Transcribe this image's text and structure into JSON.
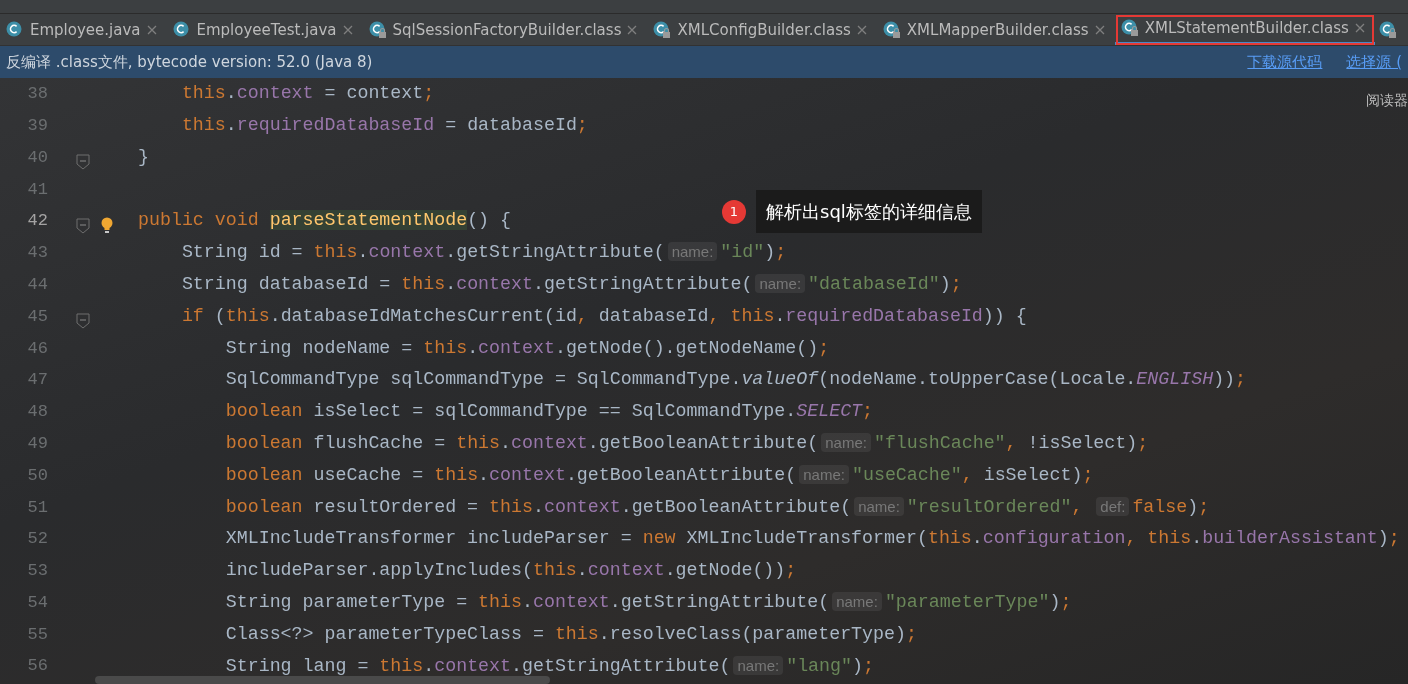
{
  "tabs": [
    {
      "label": "Employee.java",
      "kind": "java",
      "selected": false,
      "annotated": false
    },
    {
      "label": "EmployeeTest.java",
      "kind": "java",
      "selected": false,
      "annotated": false
    },
    {
      "label": "SqlSessionFactoryBuilder.class",
      "kind": "class",
      "selected": false,
      "annotated": false
    },
    {
      "label": "XMLConfigBuilder.class",
      "kind": "class",
      "selected": false,
      "annotated": false
    },
    {
      "label": "XMLMapperBuilder.class",
      "kind": "class",
      "selected": false,
      "annotated": false
    },
    {
      "label": "XMLStatementBuilder.class",
      "kind": "class",
      "selected": true,
      "annotated": true
    }
  ],
  "banner": {
    "text": "反编译 .class文件, bytecode version: 52.0 (Java 8)",
    "links": [
      "下载源代码",
      "选择源 ("
    ]
  },
  "reader_mode": "阅读器",
  "annotation": {
    "number": "1",
    "text": "解析出sql标签的详细信息"
  },
  "code_lines": [
    {
      "number": "38",
      "fold": false,
      "bulb": false,
      "current": false,
      "tokens": [
        {
          "kind": "keyword",
          "text": "    this"
        },
        {
          "kind": "plain",
          "text": "."
        },
        {
          "kind": "field",
          "text": "context"
        },
        {
          "kind": "plain",
          "text": " = context"
        },
        {
          "kind": "punct",
          "text": ";"
        }
      ]
    },
    {
      "number": "39",
      "fold": false,
      "bulb": false,
      "current": false,
      "tokens": [
        {
          "kind": "keyword",
          "text": "    this"
        },
        {
          "kind": "plain",
          "text": "."
        },
        {
          "kind": "field",
          "text": "requiredDatabaseId"
        },
        {
          "kind": "plain",
          "text": " = databaseId"
        },
        {
          "kind": "punct",
          "text": ";"
        }
      ]
    },
    {
      "number": "40",
      "fold": true,
      "bulb": false,
      "current": false,
      "tokens": [
        {
          "kind": "plain",
          "text": "}"
        }
      ]
    },
    {
      "number": "41",
      "fold": false,
      "bulb": false,
      "current": false
    },
    {
      "number": "42",
      "fold": true,
      "bulb": true,
      "current": true,
      "tokens": [
        {
          "kind": "keyword",
          "text": "public void "
        },
        {
          "kind": "declaration",
          "text": "parseStatementNode"
        },
        {
          "kind": "plain",
          "text": "() {"
        }
      ]
    },
    {
      "number": "43",
      "fold": false,
      "bulb": false,
      "current": false,
      "tokens": [
        {
          "kind": "plain",
          "text": "    String id = "
        },
        {
          "kind": "keyword",
          "text": "this"
        },
        {
          "kind": "plain",
          "text": "."
        },
        {
          "kind": "field",
          "text": "context"
        },
        {
          "kind": "plain",
          "text": ".getStringAttribute("
        },
        {
          "kind": "hint",
          "text": "name:"
        },
        {
          "kind": "string",
          "text": "\"id\""
        },
        {
          "kind": "plain",
          "text": ")"
        },
        {
          "kind": "punct",
          "text": ";"
        }
      ]
    },
    {
      "number": "44",
      "fold": false,
      "bulb": false,
      "current": false,
      "tokens": [
        {
          "kind": "plain",
          "text": "    String databaseId = "
        },
        {
          "kind": "keyword",
          "text": "this"
        },
        {
          "kind": "plain",
          "text": "."
        },
        {
          "kind": "field",
          "text": "context"
        },
        {
          "kind": "plain",
          "text": ".getStringAttribute("
        },
        {
          "kind": "hint",
          "text": "name:"
        },
        {
          "kind": "string",
          "text": "\"databaseId\""
        },
        {
          "kind": "plain",
          "text": ")"
        },
        {
          "kind": "punct",
          "text": ";"
        }
      ]
    },
    {
      "number": "45",
      "fold": true,
      "bulb": false,
      "current": false,
      "tokens": [
        {
          "kind": "keyword",
          "text": "    if"
        },
        {
          "kind": "plain",
          "text": " ("
        },
        {
          "kind": "keyword",
          "text": "this"
        },
        {
          "kind": "plain",
          "text": ".databaseIdMatchesCurrent(id"
        },
        {
          "kind": "punct",
          "text": ", "
        },
        {
          "kind": "plain",
          "text": "databaseId"
        },
        {
          "kind": "punct",
          "text": ", "
        },
        {
          "kind": "keyword",
          "text": "this"
        },
        {
          "kind": "plain",
          "text": "."
        },
        {
          "kind": "field",
          "text": "requiredDatabaseId"
        },
        {
          "kind": "plain",
          "text": ")) {"
        }
      ]
    },
    {
      "number": "46",
      "fold": false,
      "bulb": false,
      "current": false,
      "tokens": [
        {
          "kind": "plain",
          "text": "        String nodeName = "
        },
        {
          "kind": "keyword",
          "text": "this"
        },
        {
          "kind": "plain",
          "text": "."
        },
        {
          "kind": "field",
          "text": "context"
        },
        {
          "kind": "plain",
          "text": ".getNode().getNodeName()"
        },
        {
          "kind": "punct",
          "text": ";"
        }
      ]
    },
    {
      "number": "47",
      "fold": false,
      "bulb": false,
      "current": false,
      "tokens": [
        {
          "kind": "plain",
          "text": "        SqlCommandType sqlCommandType = SqlCommandType."
        },
        {
          "kind": "italic",
          "text": "valueOf"
        },
        {
          "kind": "plain",
          "text": "(nodeName.toUpperCase(Locale."
        },
        {
          "kind": "constant",
          "text": "ENGLISH"
        },
        {
          "kind": "plain",
          "text": "))"
        },
        {
          "kind": "punct",
          "text": ";"
        }
      ]
    },
    {
      "number": "48",
      "fold": false,
      "bulb": false,
      "current": false,
      "tokens": [
        {
          "kind": "keyword",
          "text": "        boolean"
        },
        {
          "kind": "plain",
          "text": " isSelect = sqlCommandType == SqlCommandType."
        },
        {
          "kind": "constant",
          "text": "SELECT"
        },
        {
          "kind": "punct",
          "text": ";"
        }
      ]
    },
    {
      "number": "49",
      "fold": false,
      "bulb": false,
      "current": false,
      "tokens": [
        {
          "kind": "keyword",
          "text": "        boolean"
        },
        {
          "kind": "plain",
          "text": " flushCache = "
        },
        {
          "kind": "keyword",
          "text": "this"
        },
        {
          "kind": "plain",
          "text": "."
        },
        {
          "kind": "field",
          "text": "context"
        },
        {
          "kind": "plain",
          "text": ".getBooleanAttribute("
        },
        {
          "kind": "hint",
          "text": "name:"
        },
        {
          "kind": "string",
          "text": "\"flushCache\""
        },
        {
          "kind": "punct",
          "text": ", "
        },
        {
          "kind": "plain",
          "text": "!isSelect)"
        },
        {
          "kind": "punct",
          "text": ";"
        }
      ]
    },
    {
      "number": "50",
      "fold": false,
      "bulb": false,
      "current": false,
      "tokens": [
        {
          "kind": "keyword",
          "text": "        boolean"
        },
        {
          "kind": "plain",
          "text": " useCache = "
        },
        {
          "kind": "keyword",
          "text": "this"
        },
        {
          "kind": "plain",
          "text": "."
        },
        {
          "kind": "field",
          "text": "context"
        },
        {
          "kind": "plain",
          "text": ".getBooleanAttribute("
        },
        {
          "kind": "hint",
          "text": "name:"
        },
        {
          "kind": "string",
          "text": "\"useCache\""
        },
        {
          "kind": "punct",
          "text": ", "
        },
        {
          "kind": "plain",
          "text": "isSelect)"
        },
        {
          "kind": "punct",
          "text": ";"
        }
      ]
    },
    {
      "number": "51",
      "fold": false,
      "bulb": false,
      "current": false,
      "tokens": [
        {
          "kind": "keyword",
          "text": "        boolean"
        },
        {
          "kind": "plain",
          "text": " resultOrdered = "
        },
        {
          "kind": "keyword",
          "text": "this"
        },
        {
          "kind": "plain",
          "text": "."
        },
        {
          "kind": "field",
          "text": "context"
        },
        {
          "kind": "plain",
          "text": ".getBooleanAttribute("
        },
        {
          "kind": "hint",
          "text": "name:"
        },
        {
          "kind": "string",
          "text": "\"resultOrdered\""
        },
        {
          "kind": "punct",
          "text": ", "
        },
        {
          "kind": "hint",
          "text": "def:"
        },
        {
          "kind": "keyword",
          "text": "false"
        },
        {
          "kind": "plain",
          "text": ")"
        },
        {
          "kind": "punct",
          "text": ";"
        }
      ]
    },
    {
      "number": "52",
      "fold": false,
      "bulb": false,
      "current": false,
      "tokens": [
        {
          "kind": "plain",
          "text": "        XMLIncludeTransformer includeParser = "
        },
        {
          "kind": "keyword",
          "text": "new"
        },
        {
          "kind": "plain",
          "text": " XMLIncludeTransformer("
        },
        {
          "kind": "keyword",
          "text": "this"
        },
        {
          "kind": "plain",
          "text": "."
        },
        {
          "kind": "field",
          "text": "configuration"
        },
        {
          "kind": "punct",
          "text": ", "
        },
        {
          "kind": "keyword",
          "text": "this"
        },
        {
          "kind": "plain",
          "text": "."
        },
        {
          "kind": "field",
          "text": "builderAssistant"
        },
        {
          "kind": "plain",
          "text": ")"
        },
        {
          "kind": "punct",
          "text": ";"
        }
      ]
    },
    {
      "number": "53",
      "fold": false,
      "bulb": false,
      "current": false,
      "tokens": [
        {
          "kind": "plain",
          "text": "        includeParser.applyIncludes("
        },
        {
          "kind": "keyword",
          "text": "this"
        },
        {
          "kind": "plain",
          "text": "."
        },
        {
          "kind": "field",
          "text": "context"
        },
        {
          "kind": "plain",
          "text": ".getNode())"
        },
        {
          "kind": "punct",
          "text": ";"
        }
      ]
    },
    {
      "number": "54",
      "fold": false,
      "bulb": false,
      "current": false,
      "tokens": [
        {
          "kind": "plain",
          "text": "        String parameterType = "
        },
        {
          "kind": "keyword",
          "text": "this"
        },
        {
          "kind": "plain",
          "text": "."
        },
        {
          "kind": "field",
          "text": "context"
        },
        {
          "kind": "plain",
          "text": ".getStringAttribute("
        },
        {
          "kind": "hint",
          "text": "name:"
        },
        {
          "kind": "string",
          "text": "\"parameterType\""
        },
        {
          "kind": "plain",
          "text": ")"
        },
        {
          "kind": "punct",
          "text": ";"
        }
      ]
    },
    {
      "number": "55",
      "fold": false,
      "bulb": false,
      "current": false,
      "tokens": [
        {
          "kind": "plain",
          "text": "        Class<?> parameterTypeClass = "
        },
        {
          "kind": "keyword",
          "text": "this"
        },
        {
          "kind": "plain",
          "text": ".resolveClass(parameterType)"
        },
        {
          "kind": "punct",
          "text": ";"
        }
      ]
    },
    {
      "number": "56",
      "fold": false,
      "bulb": false,
      "current": false,
      "tokens": [
        {
          "kind": "plain",
          "text": "        String lang = "
        },
        {
          "kind": "keyword",
          "text": "this"
        },
        {
          "kind": "plain",
          "text": "."
        },
        {
          "kind": "field",
          "text": "context"
        },
        {
          "kind": "plain",
          "text": ".getStringAttribute("
        },
        {
          "kind": "hint",
          "text": "name:"
        },
        {
          "kind": "string",
          "text": "\"lang\""
        },
        {
          "kind": "plain",
          "text": ")"
        },
        {
          "kind": "punct",
          "text": ";"
        }
      ]
    }
  ]
}
